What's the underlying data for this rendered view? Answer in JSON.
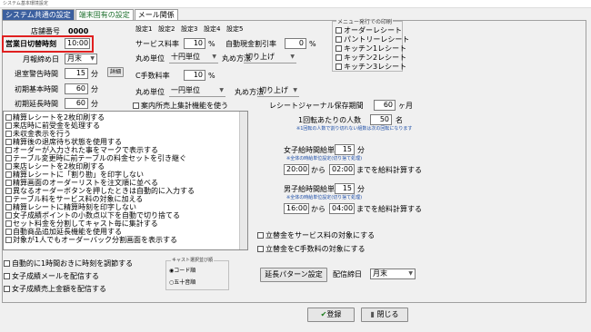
{
  "window": {
    "title": "システム基本環境設定"
  },
  "tabs": [
    {
      "label": "システム共通の設定",
      "active": true
    },
    {
      "label": "端末固有の設定",
      "active": false
    },
    {
      "label": "メール関係",
      "active": false
    }
  ],
  "left": {
    "store_number": {
      "label": "店舗番号",
      "value": "0000"
    },
    "business_day_switch": {
      "label": "営業日切替時刻",
      "value": "10:00"
    },
    "month_close_day": {
      "label": "月報締め日",
      "value": "月末"
    },
    "exit_warning_time": {
      "label": "退室警告時間",
      "value": "15",
      "unit": "分",
      "detail_button": "詳細"
    },
    "initial_base_time": {
      "label": "初期基本時間",
      "value": "60",
      "unit": "分"
    },
    "initial_extension_time": {
      "label": "初期延長時間",
      "value": "60",
      "unit": "分"
    }
  },
  "settings_tabs": [
    "設定1",
    "設定2",
    "設定3",
    "設定4",
    "設定5"
  ],
  "service": {
    "service_rate_label": "サービス料率",
    "service_rate_value": "10",
    "percent": "%",
    "auto_cash_discount_label": "自動現金割引率",
    "auto_cash_discount_value": "0",
    "rounding_unit_label": "丸め単位",
    "rounding_unit_value": "十円単位",
    "rounding_method_label": "丸め方法",
    "rounding_method_value": "切り上げ",
    "c_fee_rate_label": "C手数料率",
    "c_fee_rate_value": "10",
    "rounding_unit2_value": "一円単位",
    "rounding_method2_value": "切り上げ"
  },
  "menu_print_group": {
    "title": "メニュー発行での印刷",
    "items": [
      "オーダーレシート",
      "パントリーレシート",
      "キッチン1レシート",
      "キッチン2レシート",
      "キッチン3レシート"
    ]
  },
  "guide_total_checkbox": "案内所売上集計機能を使う",
  "options": [
    "精算レシートを2枚印刷する",
    "来店時に前受金を処理する",
    "未収金表示を行う",
    "精算後の退席待ち状態を使用する",
    "オーダーが入力された事をマークで表示する",
    "テーブル変更時に前テーブルの料金セットを引き継ぐ",
    "来店レシートを2枚印刷する",
    "精算レシートに「割り勘」を印字しない",
    "精算画面のオーダーリストを注文順に並べる",
    "異なるオーダーボタンを押したときは自動的に入力する",
    "テーブル料をサービス料の対象に加える",
    "精算レシートに精算時刻を印字しない",
    "女子成績ポイントの小数点以下を自動で切り捨てる",
    "セット料金を分割してキャスト毎に集計する",
    "自動商品追加延長機能を使用する",
    "対象が1人でもオーダーバック分割画面を表示する"
  ],
  "bottom_checks": [
    "自動的に1時間おきに時刻を調節する",
    "女子成績メールを配信する",
    "女子成績売上金額を配信する"
  ],
  "cast_sort": {
    "title": "キャスト選択並び順",
    "options": [
      "コード順",
      "五十音順"
    ],
    "selected": 0
  },
  "journal": {
    "retention_label": "レシートジャーナル保存期間",
    "retention_value": "60",
    "retention_unit": "ヶ月",
    "items_per_page_label": "1回転あたりの人数",
    "items_per_page_value": "50",
    "items_per_page_unit": "名",
    "note": "※1回転の人数で割り切れない組数は次の回転になります"
  },
  "female_pay": {
    "unit_label": "女子給時間給単位",
    "unit_value": "15",
    "unit": "分",
    "note": "※全体の時給単位設定(切り捨て処理)",
    "from": "20:00",
    "to": "02:00",
    "from_label": "から",
    "to_label": "までを給料計算する"
  },
  "male_pay": {
    "unit_label": "男子給時間給単位",
    "unit_value": "15",
    "unit": "分",
    "note": "※全体の時給単位設定(切り捨て処理)",
    "from": "16:00",
    "to": "04:00",
    "from_label": "から",
    "to_label": "までを給料計算する"
  },
  "advance_checks": [
    "立替金をサービス料の対象にする",
    "立替金をC手数料の対象にする"
  ],
  "extension_pattern_button": "延長パターン設定",
  "delivery_close_day": {
    "label": "配信締日",
    "value": "月末"
  },
  "footer": {
    "register_button": "登録",
    "close_button": "閉じる"
  }
}
